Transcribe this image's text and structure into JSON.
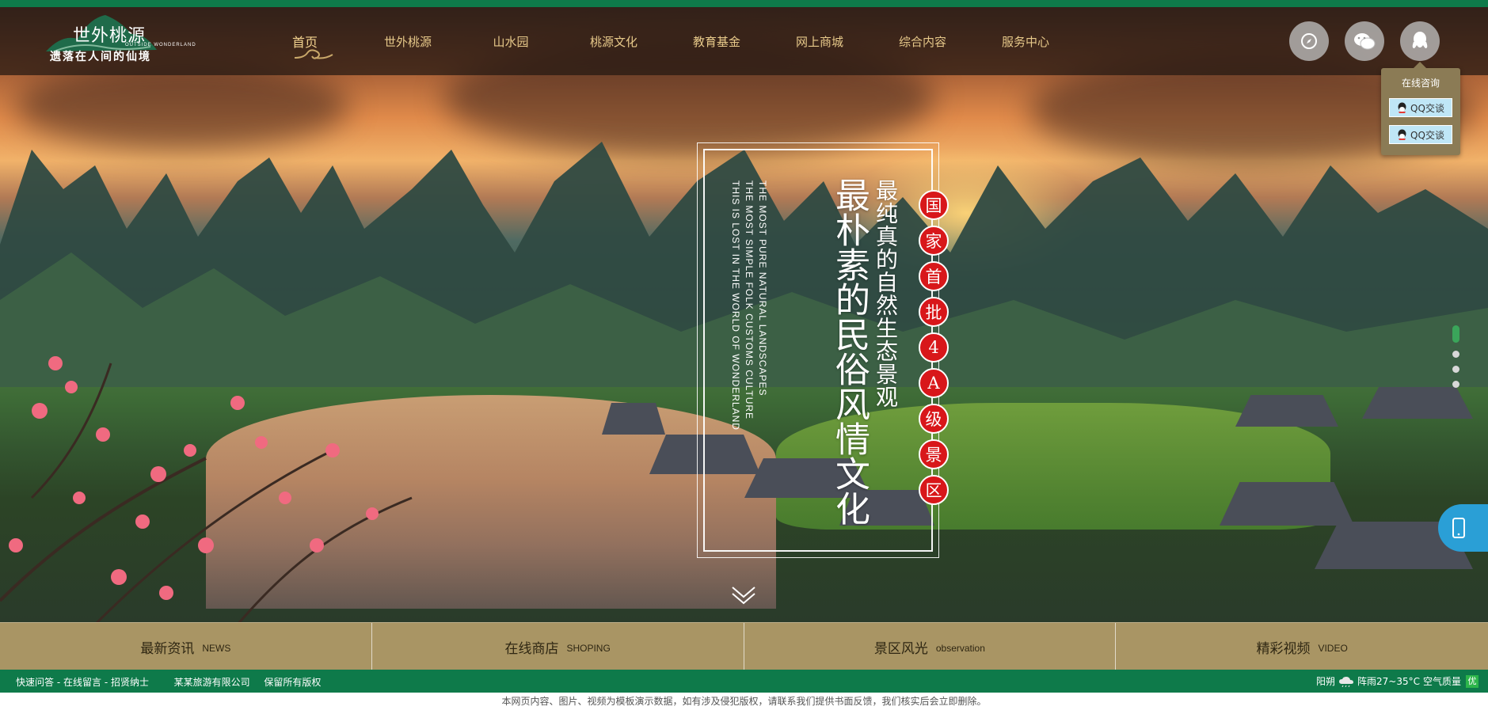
{
  "header": {
    "logo_cn": "世外桃源",
    "logo_en": "OUTSIDE WONDERLAND",
    "logo_tagline": "遗落在人间的仙境"
  },
  "nav": [
    {
      "label": "首页",
      "active": true
    },
    {
      "label": "世外桃源"
    },
    {
      "label": "山水园"
    },
    {
      "label": "桃源文化"
    },
    {
      "label": "教育基金"
    },
    {
      "label": "网上商城"
    },
    {
      "label": "综合内容"
    },
    {
      "label": "服务中心"
    }
  ],
  "header_icons": [
    "compass-icon",
    "wechat-icon",
    "qq-icon"
  ],
  "consult": {
    "title": "在线咨询",
    "buttons": [
      "QQ交谈",
      "QQ交谈"
    ]
  },
  "hero": {
    "english_lines": [
      "THE MOST PURE NATURAL LANDSCAPES",
      "THE MOST SIMPLE FOLK CUSTOMS CULTURE",
      "THIS IS LOST IN THE WORLD OF WONDERLAND"
    ],
    "slogan_1": "最纯真的自然生态景观",
    "slogan_2": "最朴素的民俗风情文化",
    "badge_chars": [
      "国",
      "家",
      "首",
      "批",
      "4",
      "A",
      "级",
      "景",
      "区"
    ]
  },
  "categories": [
    {
      "cn": "最新资讯",
      "en": "NEWS"
    },
    {
      "cn": "在线商店",
      "en": "SHOPING"
    },
    {
      "cn": "景区风光",
      "en": "observation"
    },
    {
      "cn": "精彩视频",
      "en": "VIDEO"
    }
  ],
  "footer": {
    "quick_q": "快速问答",
    "message": "在线留言",
    "recruit": "招贤纳士",
    "sep": " - ",
    "company": "某某旅游有限公司",
    "rights": "保留所有版权",
    "weather_day": "阳朔",
    "weather_desc": "阵雨27~35°C",
    "air_label": "空气质量",
    "air_value": "优"
  },
  "disclaimer": "本网页内容、图片、视频为模板演示数据，如有涉及侵犯版权，请联系我们提供书面反馈，我们核实后会立即删除。",
  "colors": {
    "brand_green": "#0e7a4a",
    "nav_gold": "#e7c98a",
    "category_bar": "#a38d58",
    "badge_red": "#d8171a",
    "qq_blue": "#bfe6f6"
  },
  "slider": {
    "count": 4,
    "active_index": 0
  }
}
